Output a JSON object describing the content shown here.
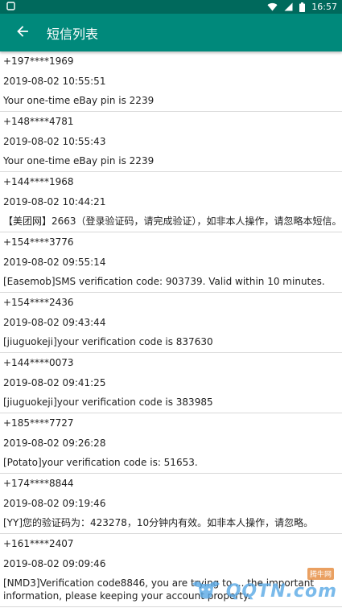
{
  "status_bar": {
    "time": "16:57",
    "icons": [
      "notification-icon",
      "wifi-icon",
      "signal-icon",
      "battery-icon"
    ]
  },
  "app_bar": {
    "title": "短信列表",
    "back_icon": "arrow-back-icon"
  },
  "colors": {
    "status_bar": "#00695c",
    "app_bar": "#00897b",
    "divider": "#d8d8d8"
  },
  "messages": [
    {
      "sender": "+197****1969",
      "time": "2019-08-02 10:55:51",
      "body": "Your one-time eBay pin is 2239"
    },
    {
      "sender": "+148****4781",
      "time": "2019-08-02 10:55:43",
      "body": "Your one-time eBay pin is 2239"
    },
    {
      "sender": "+144****1968",
      "time": "2019-08-02 10:44:21",
      "body": "【美团网】2663（登录验证码，请完成验证），如非本人操作，请忽略本短信。"
    },
    {
      "sender": "+154****3776",
      "time": "2019-08-02 09:55:14",
      "body": "[Easemob]SMS verification code: 903739. Valid within 10 minutes."
    },
    {
      "sender": "+154****2436",
      "time": "2019-08-02 09:43:44",
      "body": "[jiuguokeji]your verification code is 837630"
    },
    {
      "sender": "+144****0073",
      "time": "2019-08-02 09:41:25",
      "body": "[jiuguokeji]your verification code is 383985"
    },
    {
      "sender": "+185****7727",
      "time": "2019-08-02 09:26:28",
      "body": "[Potato]your verification code is: 51653."
    },
    {
      "sender": "+174****8844",
      "time": "2019-08-02 09:19:46",
      "body": "[YY]您的验证码为：423278，10分钟内有效。如非本人操作，请忽略。"
    },
    {
      "sender": "+161****2407",
      "time": "2019-08-02 09:09:46",
      "body": "[NMD3]Verification code8846, you are trying to ... the important information, please keeping your account property."
    }
  ],
  "watermark": {
    "brand": "QQTN.com",
    "sub": "腾牛网"
  }
}
